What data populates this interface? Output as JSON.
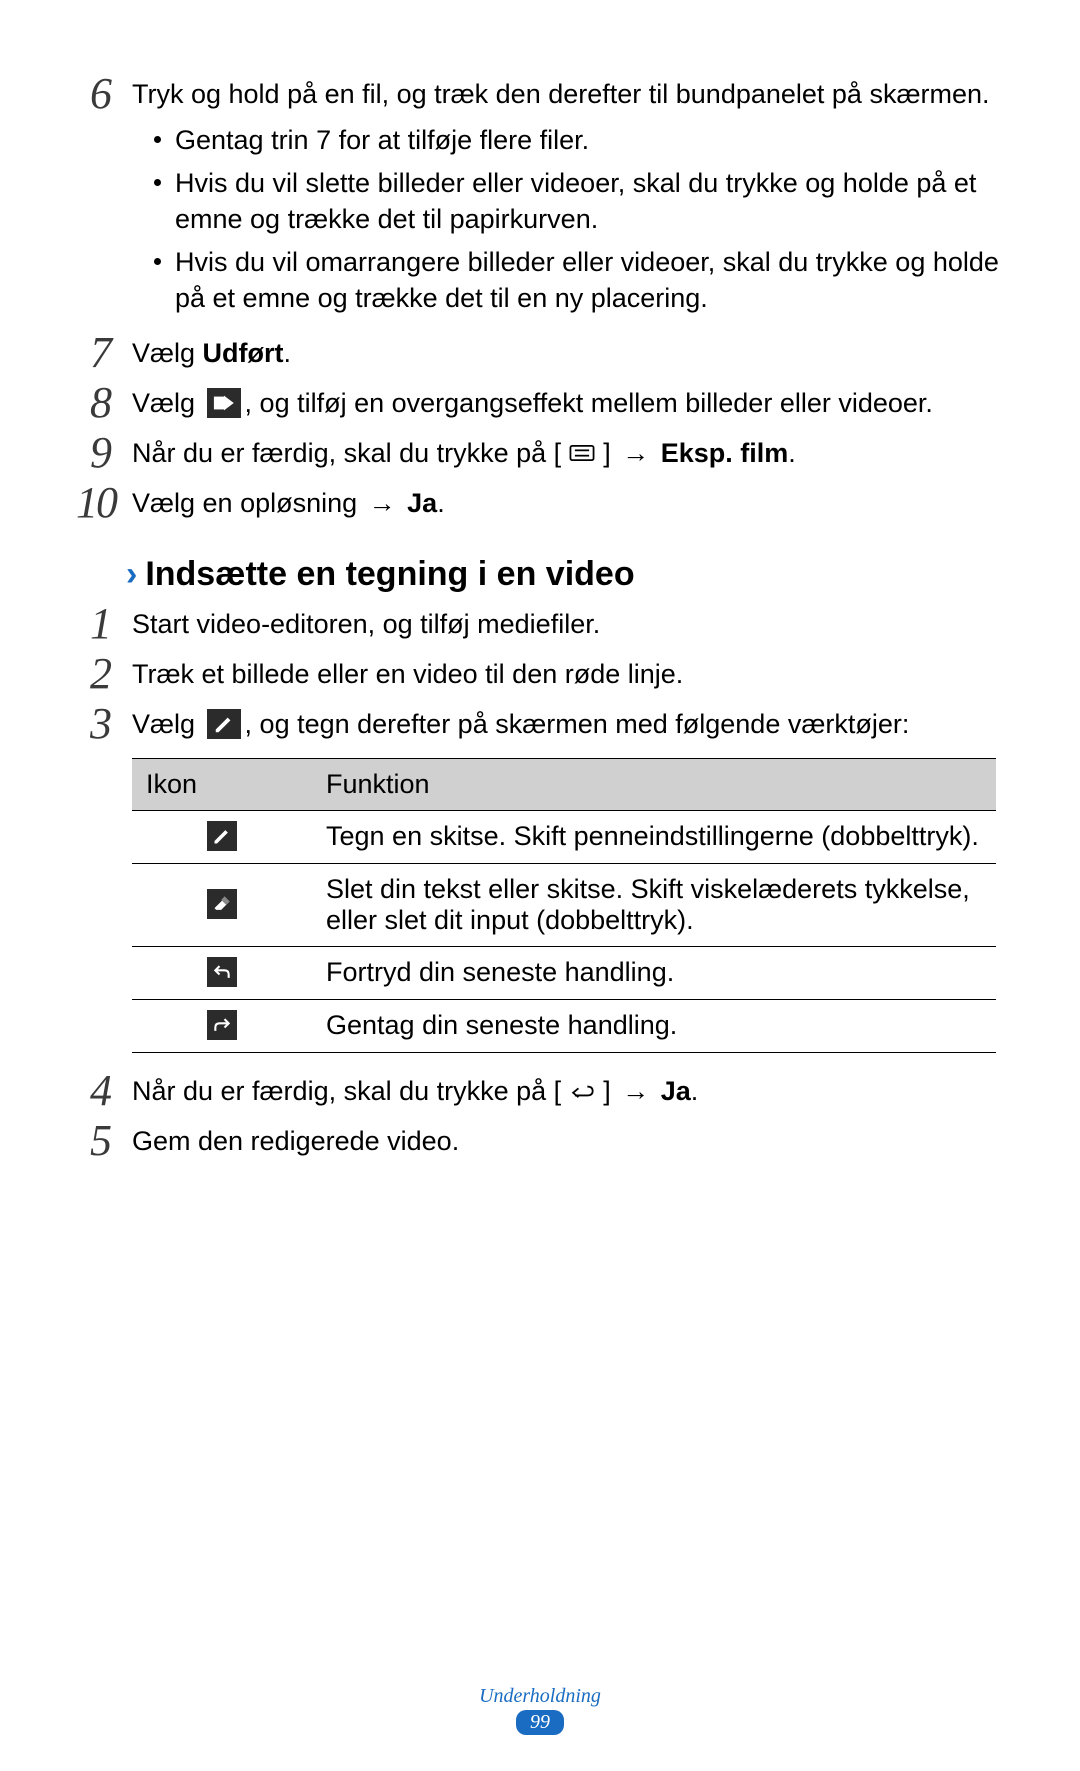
{
  "steps_a": [
    {
      "num": "6",
      "text": "Tryk og hold på en fil, og træk den derefter til bundpanelet på skærmen.",
      "bullets": [
        "Gentag trin 7 for at tilføje flere filer.",
        "Hvis du vil slette billeder eller videoer, skal du trykke og holde på et emne og trække det til papirkurven.",
        "Hvis du vil omarrangere billeder eller videoer, skal du trykke og holde på et emne og trække det til en ny placering."
      ]
    },
    {
      "num": "7",
      "pre": "Vælg ",
      "bold": "Udført",
      "post": "."
    },
    {
      "num": "8",
      "pre": "Vælg ",
      "icon": "transition",
      "post": ", og tilføj en overgangseffekt mellem billeder eller videoer."
    },
    {
      "num": "9",
      "pre": "Når du er færdig, skal du trykke på [",
      "icon": "menu",
      "mid": "] ",
      "arrow": "→",
      "bold": " Eksp. film",
      "post": "."
    },
    {
      "num": "10",
      "pre": "Vælg en opløsning ",
      "arrow": "→",
      "bold": " Ja",
      "post": "."
    }
  ],
  "section_title": "Indsætte en tegning i en video",
  "steps_b": [
    {
      "num": "1",
      "text": "Start video-editoren, og tilføj mediefiler."
    },
    {
      "num": "2",
      "text": "Træk et billede eller en video til den røde linje."
    },
    {
      "num": "3",
      "pre": "Vælg ",
      "icon": "pencil",
      "post": ", og tegn derefter på skærmen med følgende værktøjer:"
    }
  ],
  "table": {
    "h1": "Ikon",
    "h2": "Funktion",
    "rows": [
      {
        "icon": "pencil",
        "text": "Tegn en skitse. Skift penneindstillingerne (dobbelttryk)."
      },
      {
        "icon": "eraser",
        "text": "Slet din tekst eller skitse. Skift viskelæderets tykkelse, eller slet dit input (dobbelttryk)."
      },
      {
        "icon": "undo",
        "text": "Fortryd din seneste handling."
      },
      {
        "icon": "redo",
        "text": "Gentag din seneste handling."
      }
    ]
  },
  "steps_c": [
    {
      "num": "4",
      "pre": "Når du er færdig, skal du trykke på [",
      "icon": "back",
      "mid": "] ",
      "arrow": "→",
      "bold": " Ja",
      "post": "."
    },
    {
      "num": "5",
      "text": "Gem den redigerede video."
    }
  ],
  "footer": {
    "label": "Underholdning",
    "page": "99"
  }
}
